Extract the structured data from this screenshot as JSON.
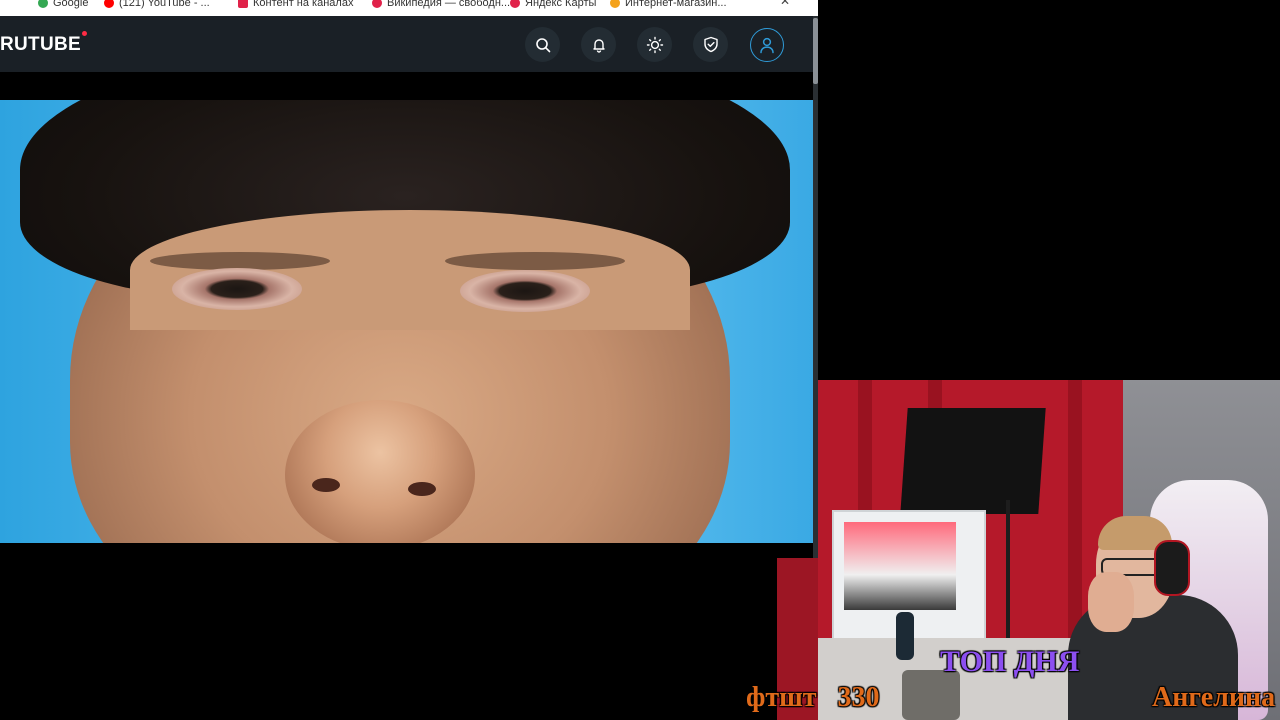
{
  "browser": {
    "bookmarks": [
      "Google",
      "(121) YouTube - ...",
      "Контент на каналах",
      "Википедия — свободн...",
      "Яндекс Карты",
      "Интернет-магазин..."
    ],
    "close_glyph": "✕"
  },
  "header": {
    "logo_text": "RUTUBE",
    "icons": [
      "search-icon",
      "bell-icon",
      "theme-sun-icon",
      "shield-check-icon",
      "profile-icon"
    ],
    "colors": {
      "background": "#1a2026",
      "accent": "#2f9bd8",
      "logo_dot": "#ff2b44"
    }
  },
  "stream_overlay": {
    "top_line": "ТОП ДНЯ",
    "left_user": "фтшт",
    "left_value": "330",
    "right_user": "Ангелина",
    "colors": {
      "top_line": "#8c4ff0",
      "left": "#e06a1a",
      "right": "#e06a1a"
    }
  }
}
